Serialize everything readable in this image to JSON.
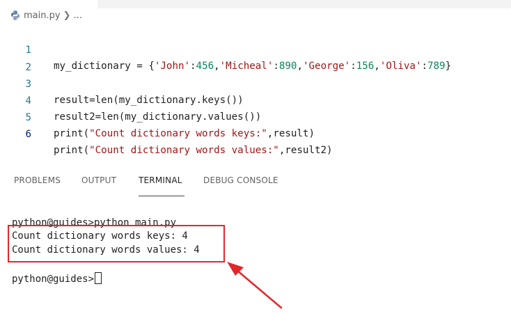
{
  "breadcrumb": {
    "file": "main.py",
    "ellipsis": "..."
  },
  "editor": {
    "lines": [
      {
        "num": "1",
        "text": "my_dictionary = {'John':456,'Micheal':890,'George':156,'Oliva':789}"
      },
      {
        "num": "2",
        "text": ""
      },
      {
        "num": "3",
        "text": "result=len(my_dictionary.keys())"
      },
      {
        "num": "4",
        "text": "result2=len(my_dictionary.values())"
      },
      {
        "num": "5",
        "text": "print(\"Count dictionary words keys:\",result)"
      },
      {
        "num": "6",
        "text": "print(\"Count dictionary words values:\",result2)"
      }
    ],
    "active_line": "6"
  },
  "panel": {
    "tabs": [
      {
        "label": "PROBLEMS",
        "active": false
      },
      {
        "label": "OUTPUT",
        "active": false
      },
      {
        "label": "TERMINAL",
        "active": true
      },
      {
        "label": "DEBUG CONSOLE",
        "active": false
      }
    ]
  },
  "terminal": {
    "lines": [
      "python@guides>python main.py",
      "Count dictionary words keys: 4",
      "Count dictionary words values: 4",
      "",
      "python@guides>"
    ]
  },
  "colors": {
    "annotation_red": "#e2262a",
    "line_number": "#237893",
    "string": "#a31515",
    "number": "#098658"
  },
  "icons": {
    "file_icon": "python-icon",
    "breadcrumb_separator": "chevron-right-icon"
  }
}
